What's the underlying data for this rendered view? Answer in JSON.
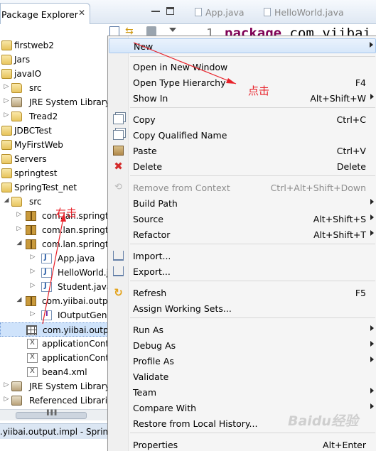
{
  "package_explorer": {
    "tab_title": "Package Explorer",
    "close_glyph": "✕",
    "tree": [
      {
        "label": "firstweb2",
        "icon": "project-icon",
        "twisty": ""
      },
      {
        "label": "Jars",
        "icon": "folder-icon",
        "twisty": ""
      },
      {
        "label": "javaIO",
        "icon": "project-icon",
        "twisty": ""
      },
      {
        "label": "src",
        "icon": "folder-icon",
        "twisty": "▷"
      },
      {
        "label": "JRE System Library",
        "icon": "jar-icon",
        "twisty": "▷"
      },
      {
        "label": "Tread2",
        "icon": "folder-icon",
        "twisty": "▷"
      },
      {
        "label": "JDBCTest",
        "icon": "project-icon",
        "twisty": ""
      },
      {
        "label": "MyFirstWeb",
        "icon": "project-icon",
        "twisty": ""
      },
      {
        "label": "Servers",
        "icon": "folder-icon",
        "twisty": ""
      },
      {
        "label": "springtest",
        "icon": "project-icon",
        "twisty": ""
      },
      {
        "label": "SpringTest_net",
        "icon": "project-icon",
        "twisty": ""
      },
      {
        "label": "src",
        "icon": "folder-icon",
        "twisty": "◢"
      },
      {
        "label": "com.lan.springte",
        "icon": "package-icon",
        "twisty": "▷"
      },
      {
        "label": "com.lan.springte",
        "icon": "package-icon",
        "twisty": "▷"
      },
      {
        "label": "com.lan.springte",
        "icon": "package-icon",
        "twisty": "◢"
      },
      {
        "label": "App.java",
        "icon": "java-file-icon",
        "twisty": "▷"
      },
      {
        "label": "HelloWorld.j",
        "icon": "java-file-icon",
        "twisty": "▷"
      },
      {
        "label": "Student.java",
        "icon": "java-file-icon",
        "twisty": "▷"
      },
      {
        "label": "com.yiibai.outpu",
        "icon": "package-icon",
        "twisty": "◢"
      },
      {
        "label": "IOutputGene",
        "icon": "interface-file-icon",
        "twisty": "▷"
      },
      {
        "label": "com.yiibai.outpu",
        "icon": "package-grid-icon",
        "twisty": ""
      },
      {
        "label": "applicationCont",
        "icon": "xml-file-icon",
        "twisty": ""
      },
      {
        "label": "applicationCont",
        "icon": "xml-file-icon",
        "twisty": ""
      },
      {
        "label": "bean4.xml",
        "icon": "xml-file-icon",
        "twisty": ""
      },
      {
        "label": "JRE System Library",
        "icon": "jar-icon",
        "twisty": "▷"
      },
      {
        "label": "Referenced Librarie",
        "icon": "jar-icon",
        "twisty": "▷"
      }
    ],
    "status_text": ".yiibai.output.impl - Spring"
  },
  "editor": {
    "tabs": [
      "App.java",
      "HelloWorld.java"
    ],
    "line_number": "1",
    "code_keyword": "package",
    "code_rest": "com.yiibai"
  },
  "context_menu": {
    "items": [
      {
        "label": "New",
        "shortcut": "",
        "submenu": true,
        "highlight": true
      },
      {
        "label": "Open in New Window",
        "shortcut": ""
      },
      {
        "label": "Open Type Hierarchy",
        "shortcut": "F4"
      },
      {
        "label": "Show In",
        "shortcut": "Alt+Shift+W",
        "submenu": true
      },
      {
        "label": "Copy",
        "shortcut": "Ctrl+C",
        "icon": "copy-icon"
      },
      {
        "label": "Copy Qualified Name",
        "shortcut": "",
        "icon": "copy-icon"
      },
      {
        "label": "Paste",
        "shortcut": "Ctrl+V",
        "icon": "paste-icon"
      },
      {
        "label": "Delete",
        "shortcut": "Delete",
        "icon": "delete-icon"
      },
      {
        "label": "Remove from Context",
        "shortcut": "Ctrl+Alt+Shift+Down",
        "disabled": true,
        "icon": "remove-context-icon"
      },
      {
        "label": "Build Path",
        "shortcut": "",
        "submenu": true
      },
      {
        "label": "Source",
        "shortcut": "Alt+Shift+S",
        "submenu": true
      },
      {
        "label": "Refactor",
        "shortcut": "Alt+Shift+T",
        "submenu": true
      },
      {
        "label": "Import...",
        "shortcut": "",
        "icon": "import-icon"
      },
      {
        "label": "Export...",
        "shortcut": "",
        "icon": "export-icon"
      },
      {
        "label": "Refresh",
        "shortcut": "F5",
        "icon": "refresh-icon"
      },
      {
        "label": "Assign Working Sets...",
        "shortcut": ""
      },
      {
        "label": "Run As",
        "shortcut": "",
        "submenu": true
      },
      {
        "label": "Debug As",
        "shortcut": "",
        "submenu": true
      },
      {
        "label": "Profile As",
        "shortcut": "",
        "submenu": true
      },
      {
        "label": "Validate",
        "shortcut": ""
      },
      {
        "label": "Team",
        "shortcut": "",
        "submenu": true
      },
      {
        "label": "Compare With",
        "shortcut": "",
        "submenu": true
      },
      {
        "label": "Restore from Local History...",
        "shortcut": ""
      },
      {
        "label": "Properties",
        "shortcut": "Alt+Enter"
      }
    ]
  },
  "annotations": {
    "right_click": "右击",
    "click": "点击",
    "color": "#e8222a"
  },
  "watermark": "Baidu经验"
}
